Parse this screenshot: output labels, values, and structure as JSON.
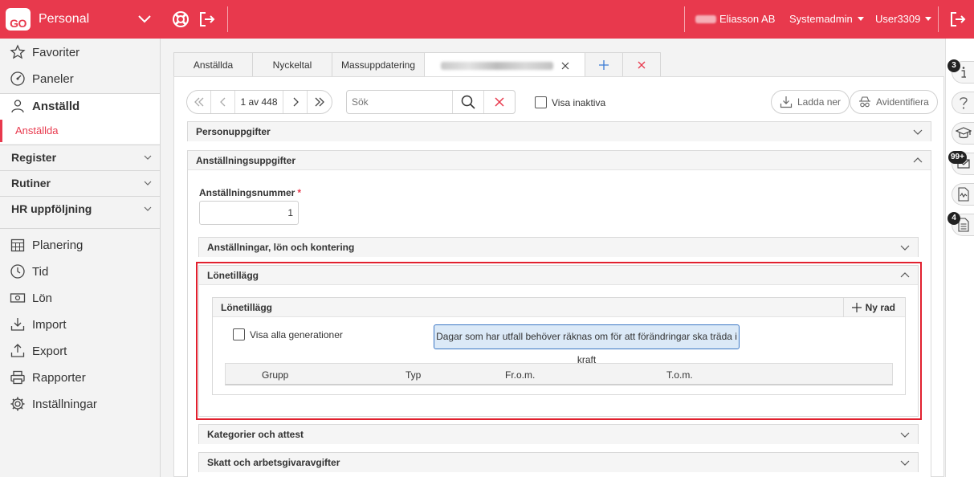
{
  "app": {
    "logo_text": "GO",
    "name": "Personal",
    "company": "Eliasson AB",
    "role": "Systemadmin",
    "user": "User3309"
  },
  "sidebar": {
    "favorites": "Favoriter",
    "panels": "Paneler",
    "employee": "Anställd",
    "employees_sub": "Anställda",
    "register": "Register",
    "routines": "Rutiner",
    "hr_followup": "HR uppföljning",
    "planning": "Planering",
    "time": "Tid",
    "salary": "Lön",
    "import": "Import",
    "export": "Export",
    "reports": "Rapporter",
    "settings": "Inställningar"
  },
  "tabs": [
    "Anställda",
    "Nyckeltal",
    "Massuppdatering"
  ],
  "toolbar": {
    "page_count": "1 av 448",
    "search_placeholder": "Sök",
    "show_inactive": "Visa inaktiva",
    "download": "Ladda ner",
    "anonymize": "Avidentifiera"
  },
  "sections": {
    "personal": "Personuppgifter",
    "employment": "Anställningsuppgifter",
    "employment_number_label": "Anställningsnummer",
    "employment_number_value": "1",
    "employments_salary": "Anställningar, lön och kontering",
    "salary_supplements": "Lönetillägg",
    "salary_supplements_inner": "Lönetillägg",
    "new_row": "Ny rad",
    "show_all_generations": "Visa alla generationer",
    "info_message": "Dagar som har utfall behöver räknas om för att förändringar ska träda i kraft",
    "grid_columns": [
      "Grupp",
      "Typ",
      "Fr.o.m.",
      "T.o.m."
    ],
    "categories": "Kategorier och attest",
    "tax": "Skatt och arbetsgivaravgifter"
  },
  "rail": {
    "badge_info": "3",
    "badge_messages": "99+",
    "badge_docs": "4"
  },
  "colors": {
    "brand": "#e8394d",
    "highlight": "#e1202e",
    "info_bg": "#dbe9f7",
    "info_border": "#3b76c4"
  }
}
